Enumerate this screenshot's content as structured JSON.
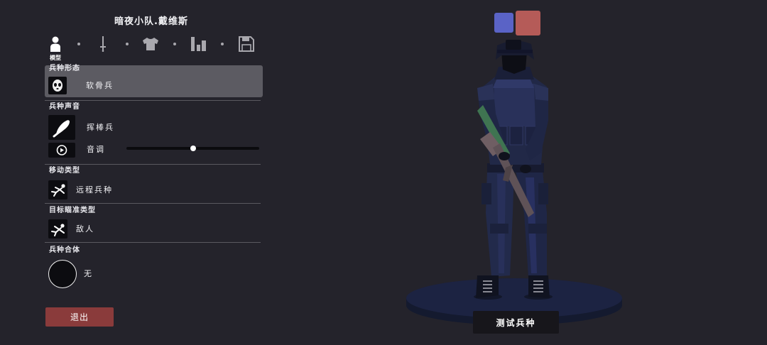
{
  "header": {
    "title": "暗夜小队.戴维斯"
  },
  "tabs": [
    {
      "icon": "person-icon",
      "label": "模型",
      "selected": true
    },
    {
      "icon": "sword-icon",
      "selected": false
    },
    {
      "icon": "shirt-icon",
      "selected": false
    },
    {
      "icon": "bar-chart-icon",
      "selected": false
    },
    {
      "icon": "floppy-disk-icon",
      "selected": false
    }
  ],
  "unit_base": {
    "label": "兵种形态",
    "value": "软骨兵",
    "icon": "mask-face-icon"
  },
  "voice": {
    "label": "兵种声音",
    "value": "挥棒兵",
    "icon": "club-icon",
    "play_icon": "play-circle-icon",
    "pitch_label": "音调",
    "pitch": 0.5
  },
  "movement": {
    "label": "移动类型",
    "value": "远程兵种",
    "icon": "ranged-stance-icon"
  },
  "targeting": {
    "label": "目标瞄准类型",
    "value": "敌人",
    "icon": "target-stance-icon"
  },
  "fusion": {
    "label": "兵种合体",
    "value": "无"
  },
  "buttons": {
    "exit": "退出",
    "test_unit": "测试兵种"
  },
  "team_colors": {
    "blue": "#5a63c6",
    "red": "#b55b58"
  },
  "colors": {
    "background": "#24232b",
    "highlight_row": "#5c5b62",
    "exit_button": "#8a3b3b",
    "test_button": "#17161b"
  }
}
